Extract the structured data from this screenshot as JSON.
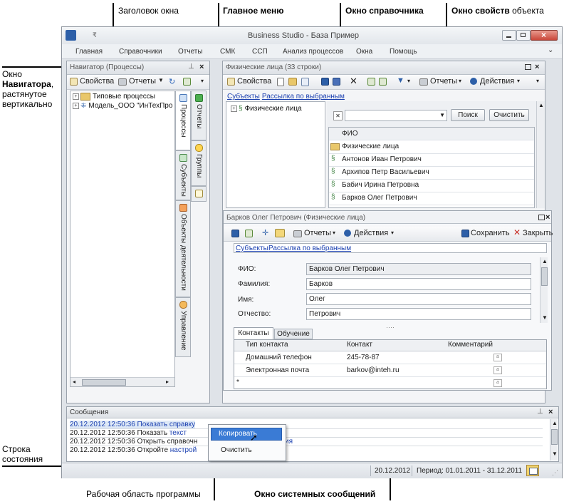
{
  "callouts": {
    "window_title": "Заголовок окна",
    "main_menu": "Главное меню",
    "directory_window": "Окно справочника",
    "properties_window_bold": "Окно свойств",
    "properties_window_rest": " объекта",
    "navigator_line1": "Окно",
    "navigator_line2_bold": "Навигатора",
    "navigator_line2_rest": ",",
    "navigator_line3": "растянутое",
    "navigator_line4": "вертикально",
    "status_line1": "Строка",
    "status_line2": "состояния",
    "work_area": "Рабочая область программы",
    "system_messages": "Окно системных сообщений"
  },
  "titlebar": {
    "title": "Business Studio - База Пример",
    "qat_symbol": "₹"
  },
  "menu": [
    "Главная",
    "Справочники",
    "Отчеты",
    "СМК",
    "ССП",
    "Анализ процессов",
    "Окна",
    "Помощь"
  ],
  "navigator": {
    "title": "Навигатор (Процессы)",
    "toolbar": {
      "properties": "Свойства",
      "reports": "Отчеты"
    },
    "tree": [
      "Типовые процессы",
      "Модель_ООО \"ИнТехПро"
    ],
    "vtabs": [
      "Процессы",
      "Субъекты",
      "Отчеты",
      "Группы",
      "Объекты деятельности",
      "Управление"
    ]
  },
  "directory": {
    "title": "Физические лица (33 строки)",
    "toolbar": {
      "properties": "Свойства",
      "reports": "Отчеты",
      "actions": "Действия"
    },
    "links": [
      "Субъекты",
      "Рассылка по выбранным"
    ],
    "tree_root": "Физические лица",
    "search_button": "Поиск",
    "clear_button": "Очистить",
    "column": "ФИО",
    "rows": [
      "Физические лица",
      "Антонов Иван Петрович",
      "Архипов Петр Васильевич",
      "Бабич Ирина Петровна",
      "Барков Олег Петрович"
    ]
  },
  "properties": {
    "title": "Барков Олег Петрович (Физические лица)",
    "toolbar": {
      "reports": "Отчеты",
      "actions": "Действия",
      "save": "Сохранить",
      "close": "Закрыть"
    },
    "links": [
      "Субъекты",
      "Рассылка по выбранным"
    ],
    "fields": [
      {
        "label": "ФИО:",
        "value": "Барков Олег Петрович"
      },
      {
        "label": "Фамилия:",
        "value": "Барков"
      },
      {
        "label": "Имя:",
        "value": "Олег"
      },
      {
        "label": "Отчество:",
        "value": "Петрович"
      }
    ],
    "tabs": [
      "Контакты",
      "Обучение"
    ],
    "contact_columns": [
      "Тип контакта",
      "Контакт",
      "Комментарий"
    ],
    "contacts": [
      {
        "type": "Домашний телефон",
        "value": "245-78-87"
      },
      {
        "type": "Электронная почта",
        "value": "barkov@inteh.ru"
      }
    ]
  },
  "messages": {
    "title": "Сообщения",
    "lines": [
      {
        "prefix": "20.12.2012 12:50:36 Показать ",
        "link": "справку",
        "suffix": ""
      },
      {
        "prefix": "20.12.2012 12:50:36 Показать ",
        "link": "текст",
        "suffix": ""
      },
      {
        "prefix": "20.12.2012 12:50:36 Открыть справочн",
        "link": "",
        "suffix": ""
      },
      {
        "prefix": "20.12.2012 12:50:36 Откройте ",
        "link": "настрой",
        "suffix": ""
      }
    ],
    "context_menu": [
      "Копировать",
      "Очистить"
    ],
    "line3_tail": "ия"
  },
  "statusbar": {
    "date": "20.12.2012",
    "period": "Период: 01.01.2011 - 31.12.2011"
  }
}
